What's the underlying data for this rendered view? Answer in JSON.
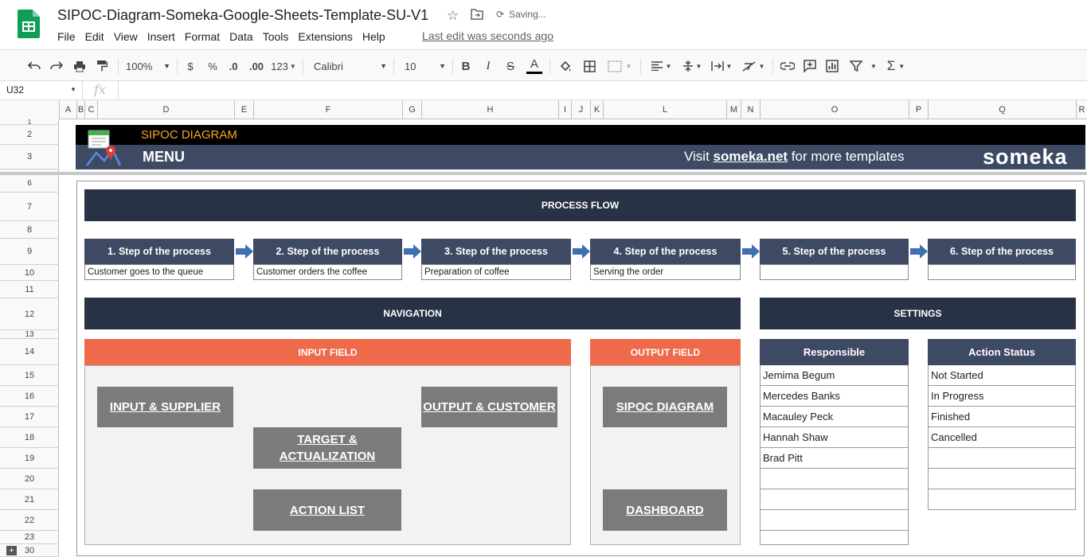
{
  "app": {
    "doc_title": "SIPOC-Diagram-Someka-Google-Sheets-Template-SU-V1",
    "saving": "Saving...",
    "menus": [
      "File",
      "Edit",
      "View",
      "Insert",
      "Format",
      "Data",
      "Tools",
      "Extensions",
      "Help"
    ],
    "last_edit": "Last edit was seconds ago"
  },
  "toolbar": {
    "zoom": "100%",
    "currency": "$",
    "percent": "%",
    "dec_decrease": ".0",
    "dec_increase": ".00",
    "more_formats": "123",
    "font": "Calibri",
    "font_size": "10",
    "bold": "B",
    "italic": "I",
    "strike": "S",
    "text_color": "A"
  },
  "formula_bar": {
    "cell_ref": "U32",
    "fx": "fx"
  },
  "columns": [
    "A",
    "B",
    "C",
    "D",
    "E",
    "F",
    "G",
    "H",
    "I",
    "J",
    "K",
    "L",
    "M",
    "N",
    "O",
    "P",
    "Q",
    "R"
  ],
  "rows": [
    "1",
    "2",
    "3",
    "6",
    "7",
    "8",
    "9",
    "10",
    "11",
    "12",
    "13",
    "14",
    "15",
    "16",
    "17",
    "18",
    "19",
    "20",
    "21",
    "22",
    "23",
    "30"
  ],
  "banner": {
    "sipoc_label": "SIPOC DIAGRAM",
    "menu_label": "MENU",
    "visit_prefix": "Visit ",
    "visit_link": "someka.net",
    "visit_suffix": " for more templates",
    "logo_text": "someka"
  },
  "process_flow": {
    "title": "PROCESS FLOW",
    "steps": [
      {
        "label": "1. Step of the process",
        "desc": "Customer goes to the queue"
      },
      {
        "label": "2. Step of the process",
        "desc": "Customer orders the coffee"
      },
      {
        "label": "3. Step of the process",
        "desc": "Preparation of coffee"
      },
      {
        "label": "4. Step of the process",
        "desc": "Serving the order"
      },
      {
        "label": "5. Step of the process",
        "desc": ""
      },
      {
        "label": "6. Step of the process",
        "desc": ""
      }
    ]
  },
  "navigation": {
    "title": "NAVIGATION",
    "input_field": "INPUT FIELD",
    "output_field": "OUTPUT FIELD",
    "buttons": {
      "input_supplier": "INPUT & SUPPLIER",
      "output_customer": "OUTPUT & CUSTOMER",
      "target_line1": "TARGET &",
      "target_line2": "ACTUALIZATION",
      "action_list": "ACTION LIST",
      "sipoc_diagram": "SIPOC DIAGRAM",
      "dashboard": "DASHBOARD"
    }
  },
  "settings": {
    "title": "SETTINGS",
    "responsible": {
      "header": "Responsible",
      "items": [
        "Jemima Begum",
        "Mercedes Banks",
        "Macauley Peck",
        "Hannah Shaw",
        "Brad Pitt",
        "",
        "",
        "",
        ""
      ]
    },
    "action_status": {
      "header": "Action Status",
      "items": [
        "Not Started",
        "In Progress",
        "Finished",
        "Cancelled",
        "",
        "",
        ""
      ]
    }
  },
  "colors": {
    "dark_navy": "#283245",
    "slate": "#3e4a63",
    "orange": "#ef6a4b",
    "gray_button": "#7b7b7b",
    "sheets_green": "#0f9d58"
  }
}
